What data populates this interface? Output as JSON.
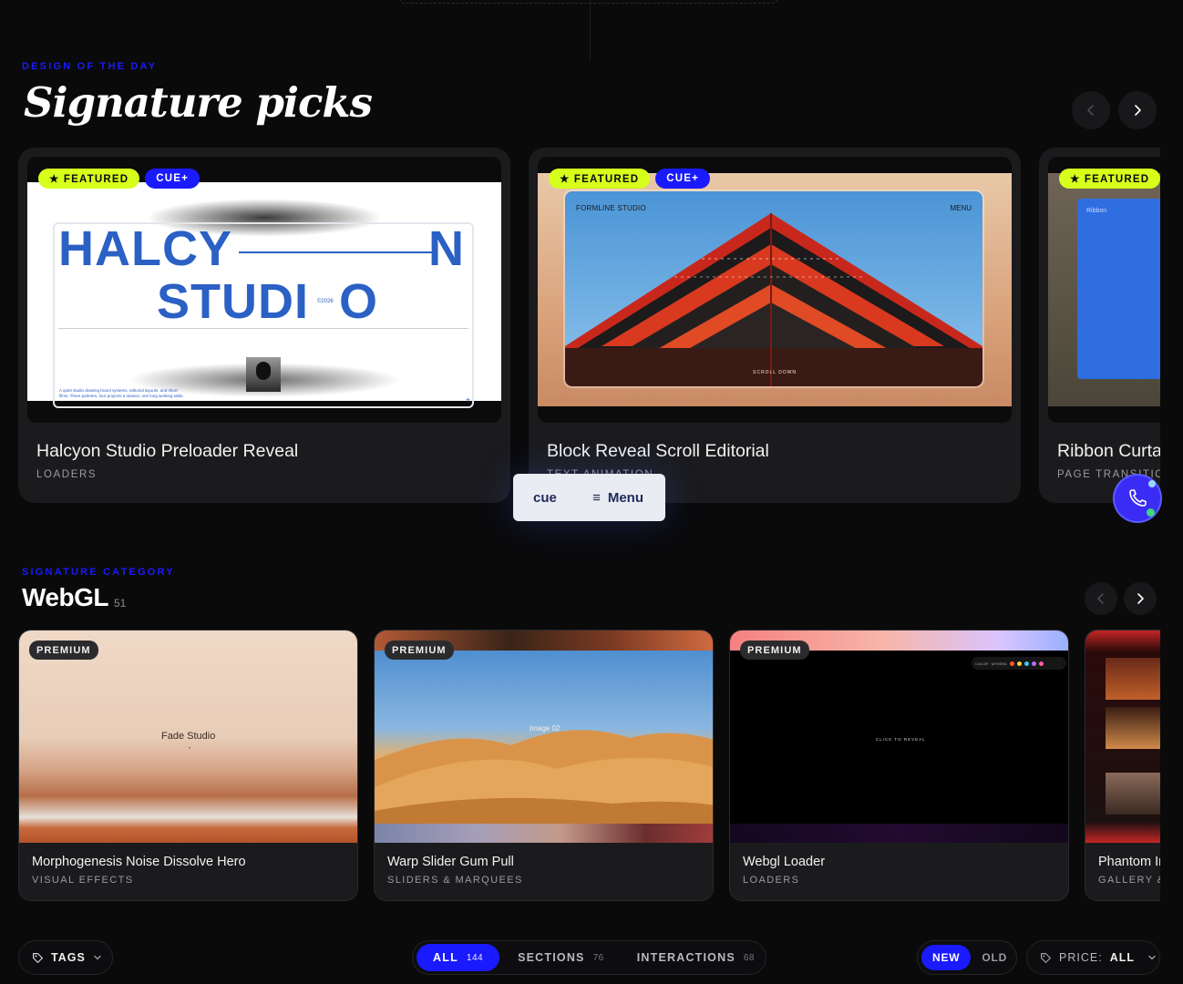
{
  "signature": {
    "eyebrow": "DESIGN OF THE DAY",
    "title": "Signature picks",
    "cards": [
      {
        "badges": [
          "★ FEATURED",
          "CUE+"
        ],
        "title": "Halcyon Studio Preloader Reveal",
        "category": "LOADERS",
        "preview": {
          "line1": "HALCY",
          "n": "N",
          "line2": "STUDI",
          "o": "O",
          "year": "©2026",
          "caption": "A quiet studio drawing brand systems, editorial layouts, and short films. Three partners, four projects a season, one long working table.",
          "plus": "+"
        }
      },
      {
        "badges": [
          "★ FEATURED",
          "CUE+"
        ],
        "title": "Block Reveal Scroll Editorial",
        "category": "TEXT ANIMATION",
        "preview": {
          "studio": "FORMLINE STUDIO",
          "menu": "MENU",
          "scroll": "SCROLL DOWN"
        }
      },
      {
        "badges": [
          "★ FEATURED"
        ],
        "title": "Ribbon Curtain",
        "category": "PAGE TRANSITION",
        "preview": {
          "label": "Ribbon"
        }
      }
    ]
  },
  "floating_menu": {
    "logo": "cue",
    "icon": "≡",
    "label": "Menu"
  },
  "category": {
    "eyebrow": "SIGNATURE CATEGORY",
    "title": "WebGL",
    "count": "51",
    "cards": [
      {
        "badge": "PREMIUM",
        "title": "Morphogenesis Noise Dissolve Hero",
        "category": "VISUAL EFFECTS",
        "preview_text": "Fade Studio"
      },
      {
        "badge": "PREMIUM",
        "title": "Warp Slider Gum Pull",
        "category": "SLIDERS & MARQUEES",
        "preview_text": "Image 02"
      },
      {
        "badge": "PREMIUM",
        "title": "Webgl Loader",
        "category": "LOADERS",
        "preview_text": "CLICK TO REVEAL",
        "hud_text": "COLOR · MYXERA"
      },
      {
        "badge": "",
        "title": "Phantom Image",
        "category": "GALLERY & SLIDERS"
      }
    ]
  },
  "filters": {
    "tags_label": "TAGS",
    "segments": [
      {
        "label": "ALL",
        "count": "144",
        "active": true
      },
      {
        "label": "SECTIONS",
        "count": "76",
        "active": false
      },
      {
        "label": "INTERACTIONS",
        "count": "68",
        "active": false
      }
    ],
    "sort": [
      {
        "label": "NEW",
        "active": true
      },
      {
        "label": "OLD",
        "active": false
      }
    ],
    "price_label": "PRICE:",
    "price_value": "ALL"
  },
  "icons": {
    "prev": "chevron-left-icon",
    "next": "chevron-right-icon",
    "tag": "tag-icon",
    "dropdown": "chevron-down-icon",
    "call": "phone-icon",
    "menu": "hamburger-icon"
  },
  "colors": {
    "accent": "#1a1aff",
    "featured_badge": "#d7ff1c",
    "background": "#0a0a0b",
    "card": "#1b1b1e"
  }
}
